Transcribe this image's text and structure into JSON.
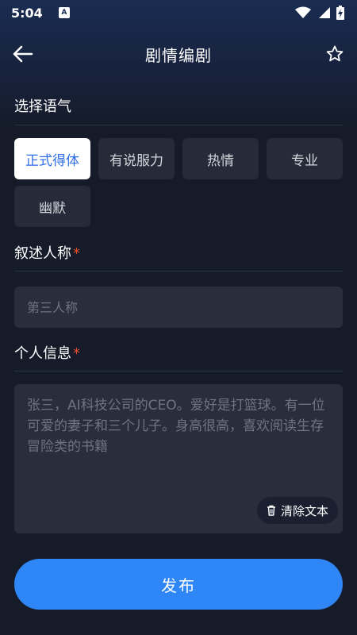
{
  "status_bar": {
    "time": "5:04",
    "notification_icon_letter": "A"
  },
  "header": {
    "title": "剧情编剧",
    "back_icon": "arrow-left-icon",
    "favorite_icon": "star-outline-icon"
  },
  "tone_section": {
    "label": "选择语气",
    "selected": "正式得体",
    "options": [
      "正式得体",
      "有说服力",
      "热情",
      "专业",
      "幽默"
    ]
  },
  "narrator_section": {
    "label": "叙述人称",
    "required_mark": "*",
    "placeholder": "第三人称"
  },
  "info_section": {
    "label": "个人信息",
    "required_mark": "*",
    "placeholder": "张三，AI科技公司的CEO。爱好是打篮球。有一位可爱的妻子和三个儿子。身高很高，喜欢阅读生存冒险类的书籍",
    "clear_label": "清除文本",
    "clear_icon": "trash-icon"
  },
  "publish_label": "发布",
  "colors": {
    "background": "#151b29",
    "accent": "#2f86f6",
    "selected_text": "#2f6fe5",
    "required": "#e8502b"
  }
}
